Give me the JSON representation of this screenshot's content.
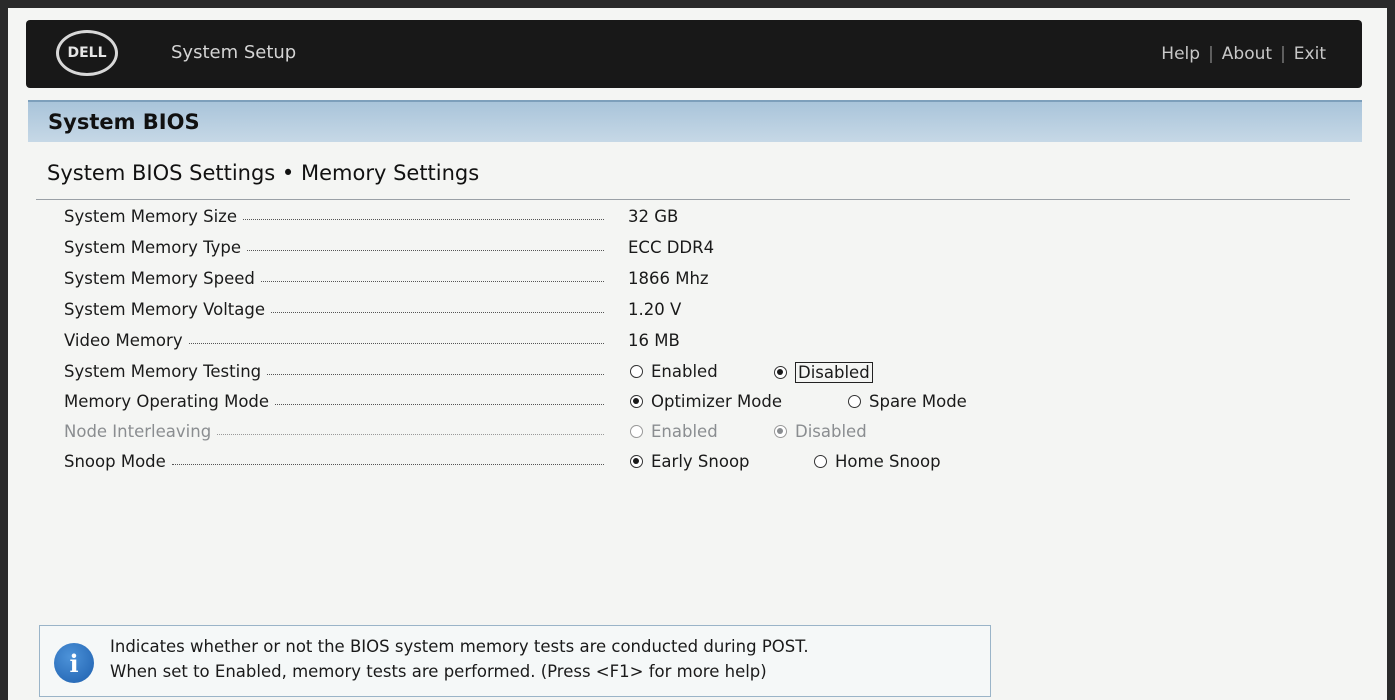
{
  "header": {
    "logo": "DELL",
    "title": "System Setup",
    "links": [
      "Help",
      "About",
      "Exit"
    ]
  },
  "section": {
    "title": "System BIOS"
  },
  "page": {
    "title": "System BIOS Settings • Memory Settings"
  },
  "settings": [
    {
      "label": "System Memory Size",
      "value": "32 GB"
    },
    {
      "label": "System Memory Type",
      "value": "ECC DDR4"
    },
    {
      "label": "System Memory Speed",
      "value": "1866 Mhz"
    },
    {
      "label": "System Memory Voltage",
      "value": "1.20 V"
    },
    {
      "label": "Video Memory",
      "value": "16 MB"
    },
    {
      "label": "System Memory Testing",
      "options": [
        "Enabled",
        "Disabled"
      ],
      "selected": "Disabled"
    },
    {
      "label": "Memory Operating Mode",
      "options": [
        "Optimizer Mode",
        "Spare Mode"
      ],
      "selected": "Optimizer Mode"
    },
    {
      "label": "Node Interleaving",
      "options": [
        "Enabled",
        "Disabled"
      ],
      "selected": "Disabled",
      "disabled": true
    },
    {
      "label": "Snoop Mode",
      "options": [
        "Early Snoop",
        "Home Snoop"
      ],
      "selected": "Early Snoop"
    }
  ],
  "help": {
    "line1": "Indicates whether or not the BIOS system memory tests are conducted during POST.",
    "line2": "When set to Enabled, memory tests are performed. (Press <F1> for more help)"
  }
}
